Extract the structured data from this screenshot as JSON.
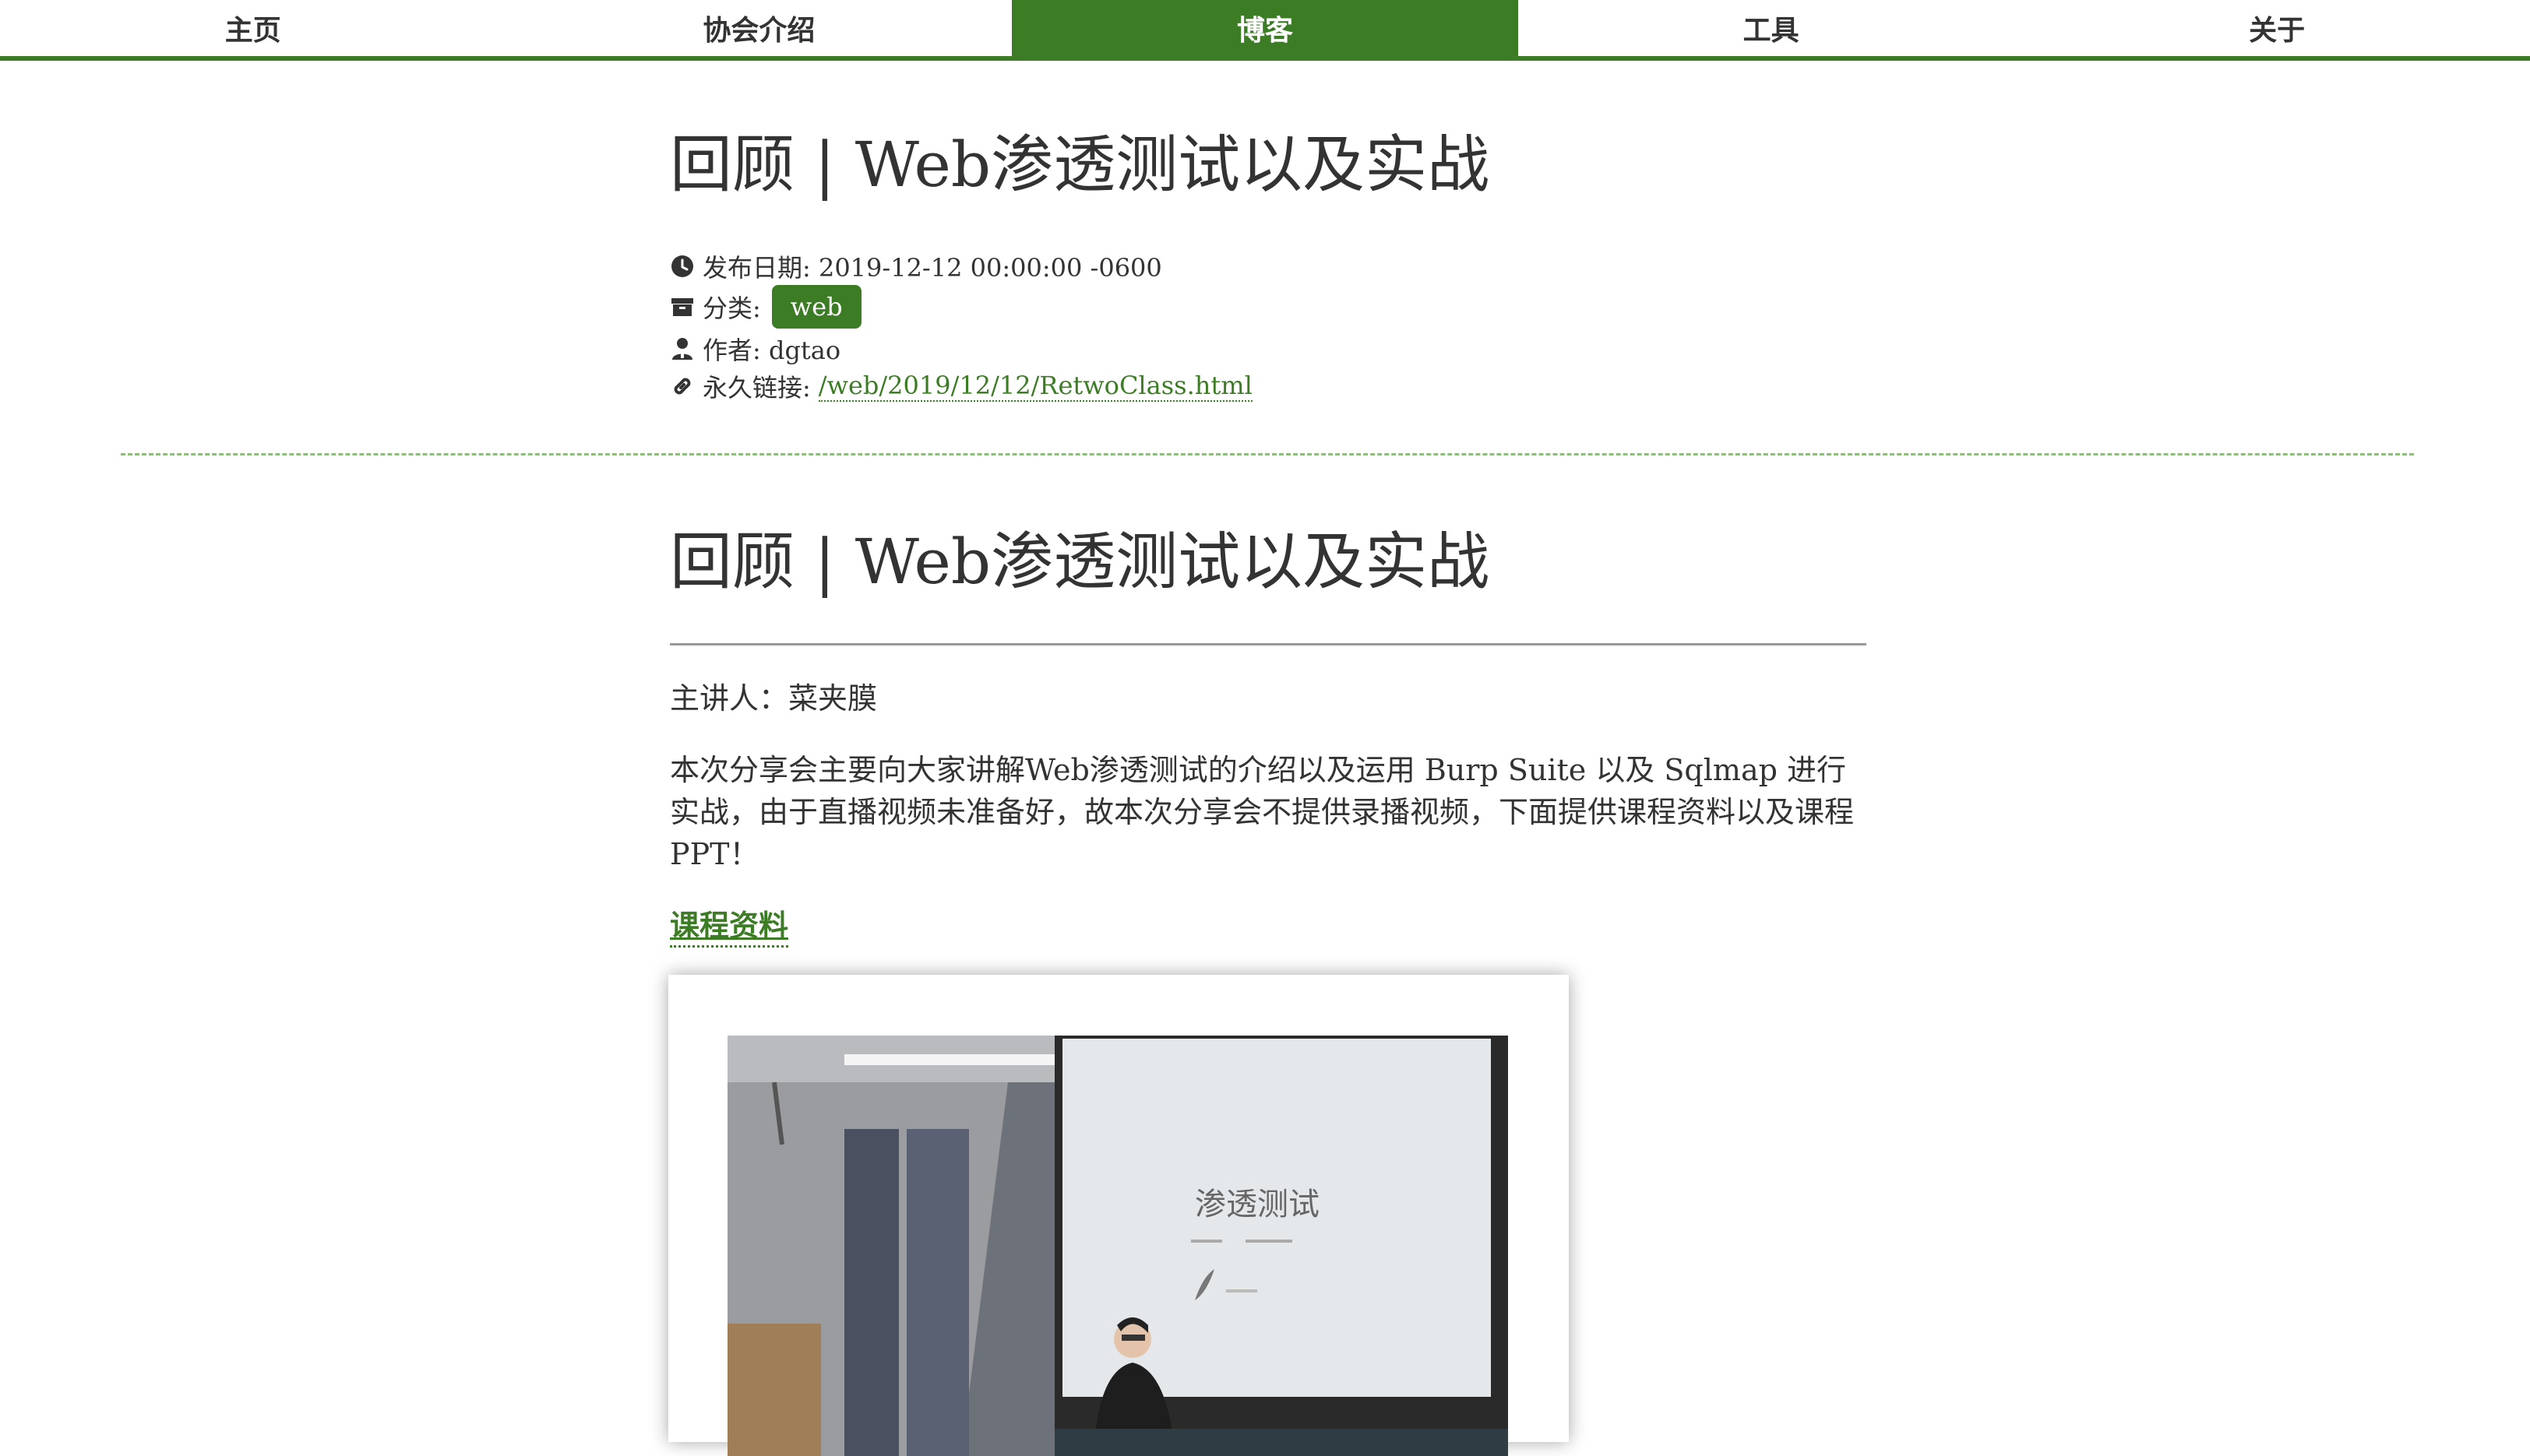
{
  "nav": {
    "items": [
      {
        "label": "主页"
      },
      {
        "label": "协会介绍"
      },
      {
        "label": "博客"
      },
      {
        "label": "工具"
      },
      {
        "label": "关于"
      }
    ],
    "active_index": 2
  },
  "post": {
    "title": "回顾 | Web渗透测试以及实战",
    "date_label": "发布日期: 2019-12-12 00:00:00 -0600",
    "category_label": "分类:",
    "category": "web",
    "author_label": "作者: dgtao",
    "permalink_label": "永久链接:",
    "permalink": "/web/2019/12/12/RetwoClass.html"
  },
  "content": {
    "heading": "回顾 | Web渗透测试以及实战",
    "speaker": "主讲人：菜夹膜",
    "intro": "本次分享会主要向大家讲解Web渗透测试的介绍以及运用 Burp Suite 以及 Sqlmap 进行实战，由于直播视频未准备好，故本次分享会不提供录播视频，下面提供课程资料以及课程PPT！",
    "materials_link": "课程资料",
    "photo_slide_text": "渗透测试"
  },
  "colors": {
    "accent": "#3c7c24",
    "text": "#333333",
    "dashed_rule": "#8fbb7f"
  },
  "icons": {
    "date": "clock-icon",
    "category": "archive-icon",
    "author": "user-icon",
    "permalink": "link-icon"
  }
}
